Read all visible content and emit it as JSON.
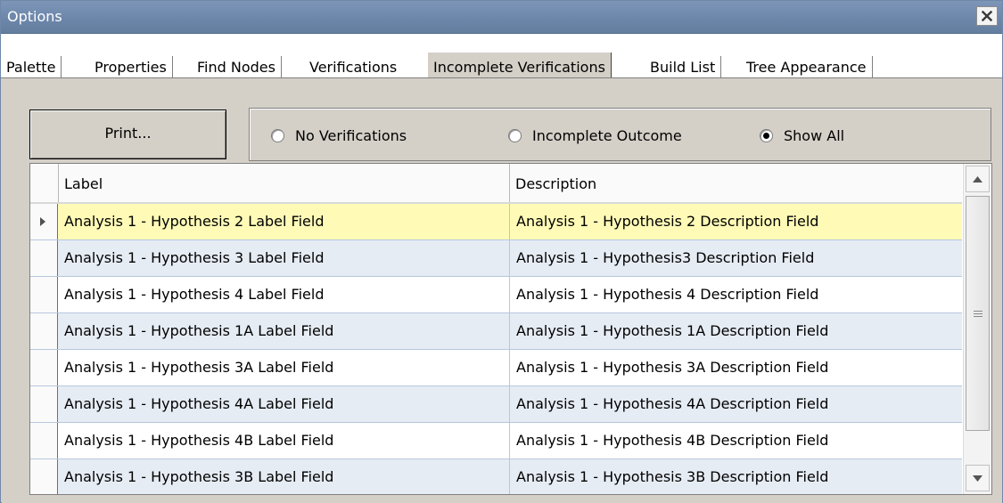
{
  "window": {
    "title": "Options"
  },
  "tabs": [
    {
      "label": "Palette"
    },
    {
      "label": "Properties"
    },
    {
      "label": "Find Nodes"
    },
    {
      "label": "Verifications"
    },
    {
      "label": "Incomplete Verifications",
      "active": true
    },
    {
      "label": "Build List"
    },
    {
      "label": "Tree Appearance"
    }
  ],
  "toolbar": {
    "print_label": "Print..."
  },
  "filter": {
    "options": [
      {
        "label": "No Verifications",
        "checked": false
      },
      {
        "label": "Incomplete Outcome",
        "checked": false
      },
      {
        "label": "Show All",
        "checked": true
      }
    ]
  },
  "grid": {
    "columns": [
      "Label",
      "Description"
    ],
    "rows": [
      {
        "label": "Analysis 1 - Hypothesis 2 Label Field",
        "description": "Analysis 1 - Hypothesis 2 Description Field"
      },
      {
        "label": "Analysis 1 - Hypothesis 3 Label Field",
        "description": "Analysis 1 - Hypothesis3 Description Field"
      },
      {
        "label": "Analysis 1 - Hypothesis 4 Label Field",
        "description": "Analysis 1 - Hypothesis 4 Description Field"
      },
      {
        "label": "Analysis 1 - Hypothesis 1A Label Field",
        "description": "Analysis 1 - Hypothesis 1A Description Field"
      },
      {
        "label": "Analysis 1 - Hypothesis 3A Label Field",
        "description": "Analysis 1 - Hypothesis 3A Description Field"
      },
      {
        "label": "Analysis 1 - Hypothesis 4A Label Field",
        "description": "Analysis 1 - Hypothesis 4A Description Field"
      },
      {
        "label": "Analysis 1 - Hypothesis 4B Label Field",
        "description": "Analysis 1 - Hypothesis 4B  Description Field"
      },
      {
        "label": "Analysis 1 - Hypothesis 3B Label Field",
        "description": "Analysis 1 - Hypothesis 3B Description Field"
      }
    ]
  }
}
